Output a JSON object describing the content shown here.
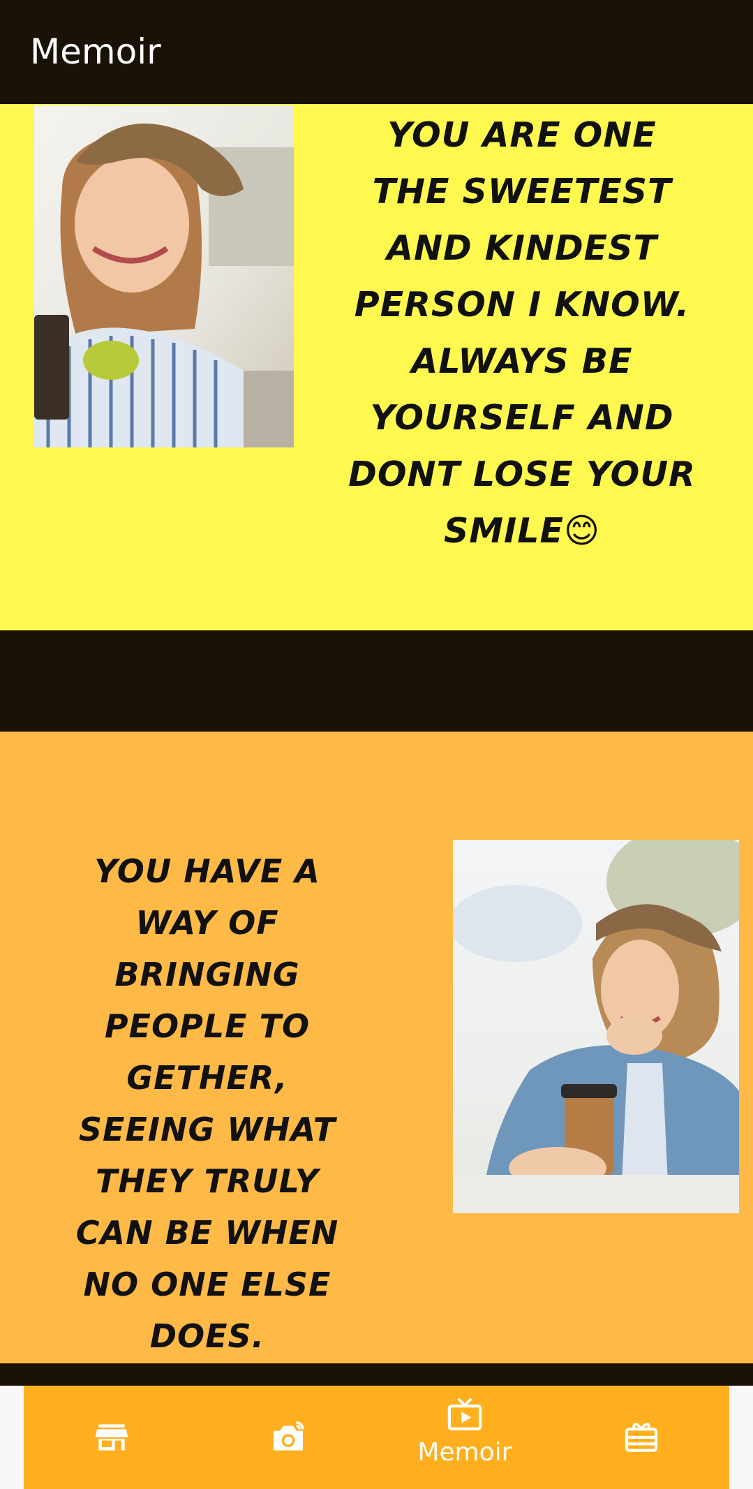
{
  "app": {
    "title": "Memoir"
  },
  "cards": [
    {
      "text": "YOU ARE ONE THE SWEETEST AND KINDEST PERSON I KNOW. ALWAYS BE YOURSELF AND DONT LOSE YOUR SMILE😊",
      "background": "#fff84f",
      "photo": "girl-with-hat-smiling-photo"
    },
    {
      "text": "YOU HAVE A WAY OF BRINGING PEOPLE TO GETHER, SEEING WHAT THEY TRULY CAN BE WHEN NO ONE ELSE DOES.",
      "background": "#ffb947",
      "photo": "girl-with-coffee-cup-photo"
    }
  ],
  "bottom_nav": {
    "background": "#ffaf1e",
    "items": [
      {
        "icon": "store-icon",
        "label": ""
      },
      {
        "icon": "camera-icon",
        "label": ""
      },
      {
        "icon": "video-play-icon",
        "label": "Memoir",
        "active": true
      },
      {
        "icon": "gift-card-icon",
        "label": ""
      }
    ]
  }
}
